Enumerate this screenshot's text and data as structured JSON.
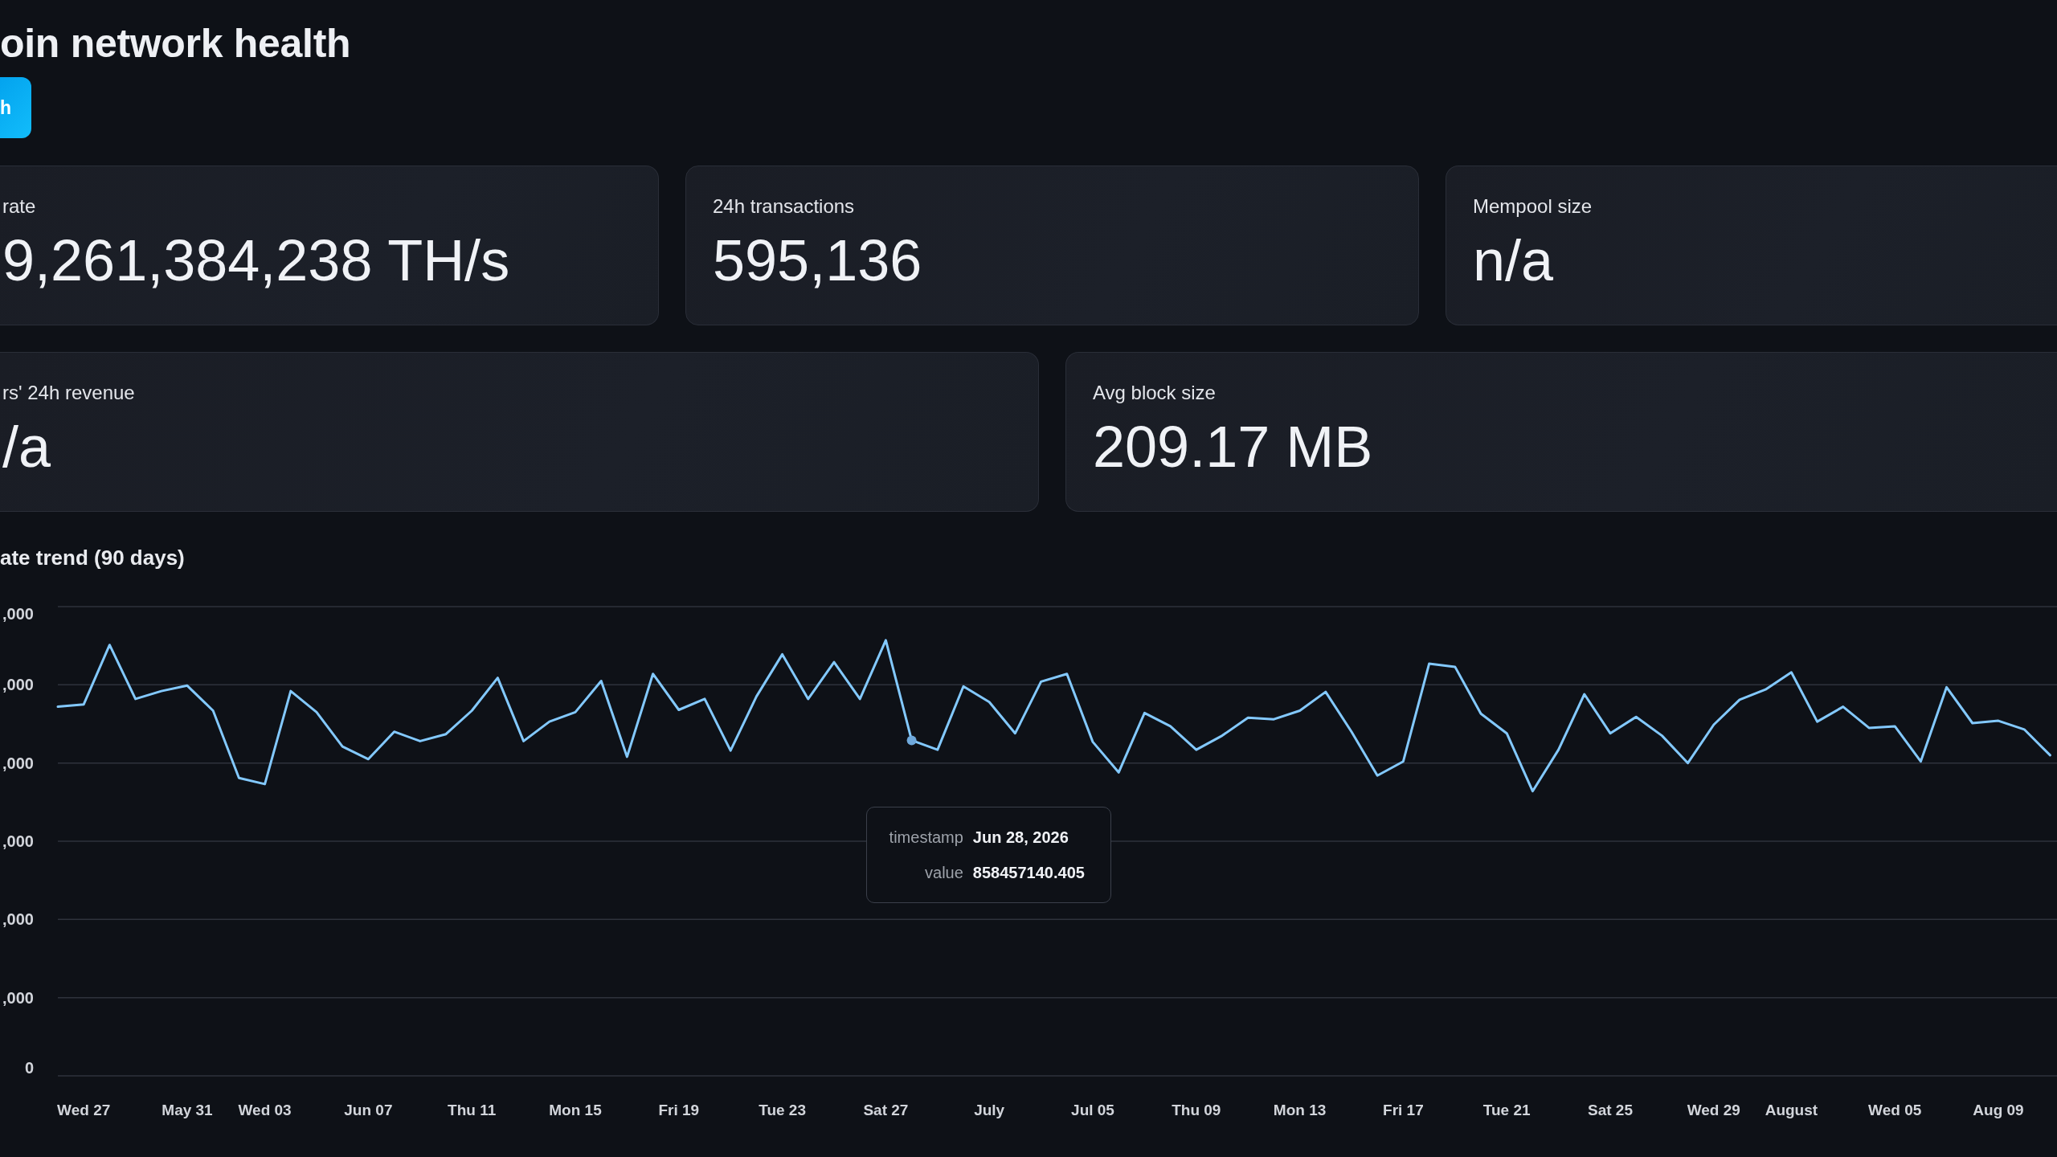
{
  "header": {
    "title": "oin network health",
    "button": "h"
  },
  "metric_rows": [
    {
      "cards": [
        {
          "label": "rate",
          "value": "9,261,384,238 TH/s"
        },
        {
          "label": "24h transactions",
          "value": "595,136"
        },
        {
          "label": "Mempool size",
          "value": "n/a"
        }
      ]
    },
    {
      "cards": [
        {
          "label": "rs' 24h revenue",
          "value": "/a"
        },
        {
          "label": "Avg block size",
          "value": "209.17 MB"
        }
      ]
    }
  ],
  "chart": {
    "title": "ate trend (90 days)",
    "y_axis_labels": [
      ",000",
      ",000",
      ",000",
      ",000",
      ",000",
      ",000",
      "0"
    ],
    "x_axis_labels": [
      "Wed 27",
      "May 31",
      "Wed 03",
      "Jun 07",
      "Thu 11",
      "Mon 15",
      "Fri 19",
      "Tue 23",
      "Sat 27",
      "July",
      "Jul 05",
      "Thu 09",
      "Mon 13",
      "Fri 17",
      "Tue 21",
      "Sat 25",
      "Wed 29",
      "August",
      "Wed 05",
      "Aug 09"
    ],
    "tooltip": {
      "rows": [
        {
          "label": "timestamp",
          "value": "Jun 28, 2026"
        },
        {
          "label": "value",
          "value": "858457140.405"
        }
      ]
    }
  }
}
